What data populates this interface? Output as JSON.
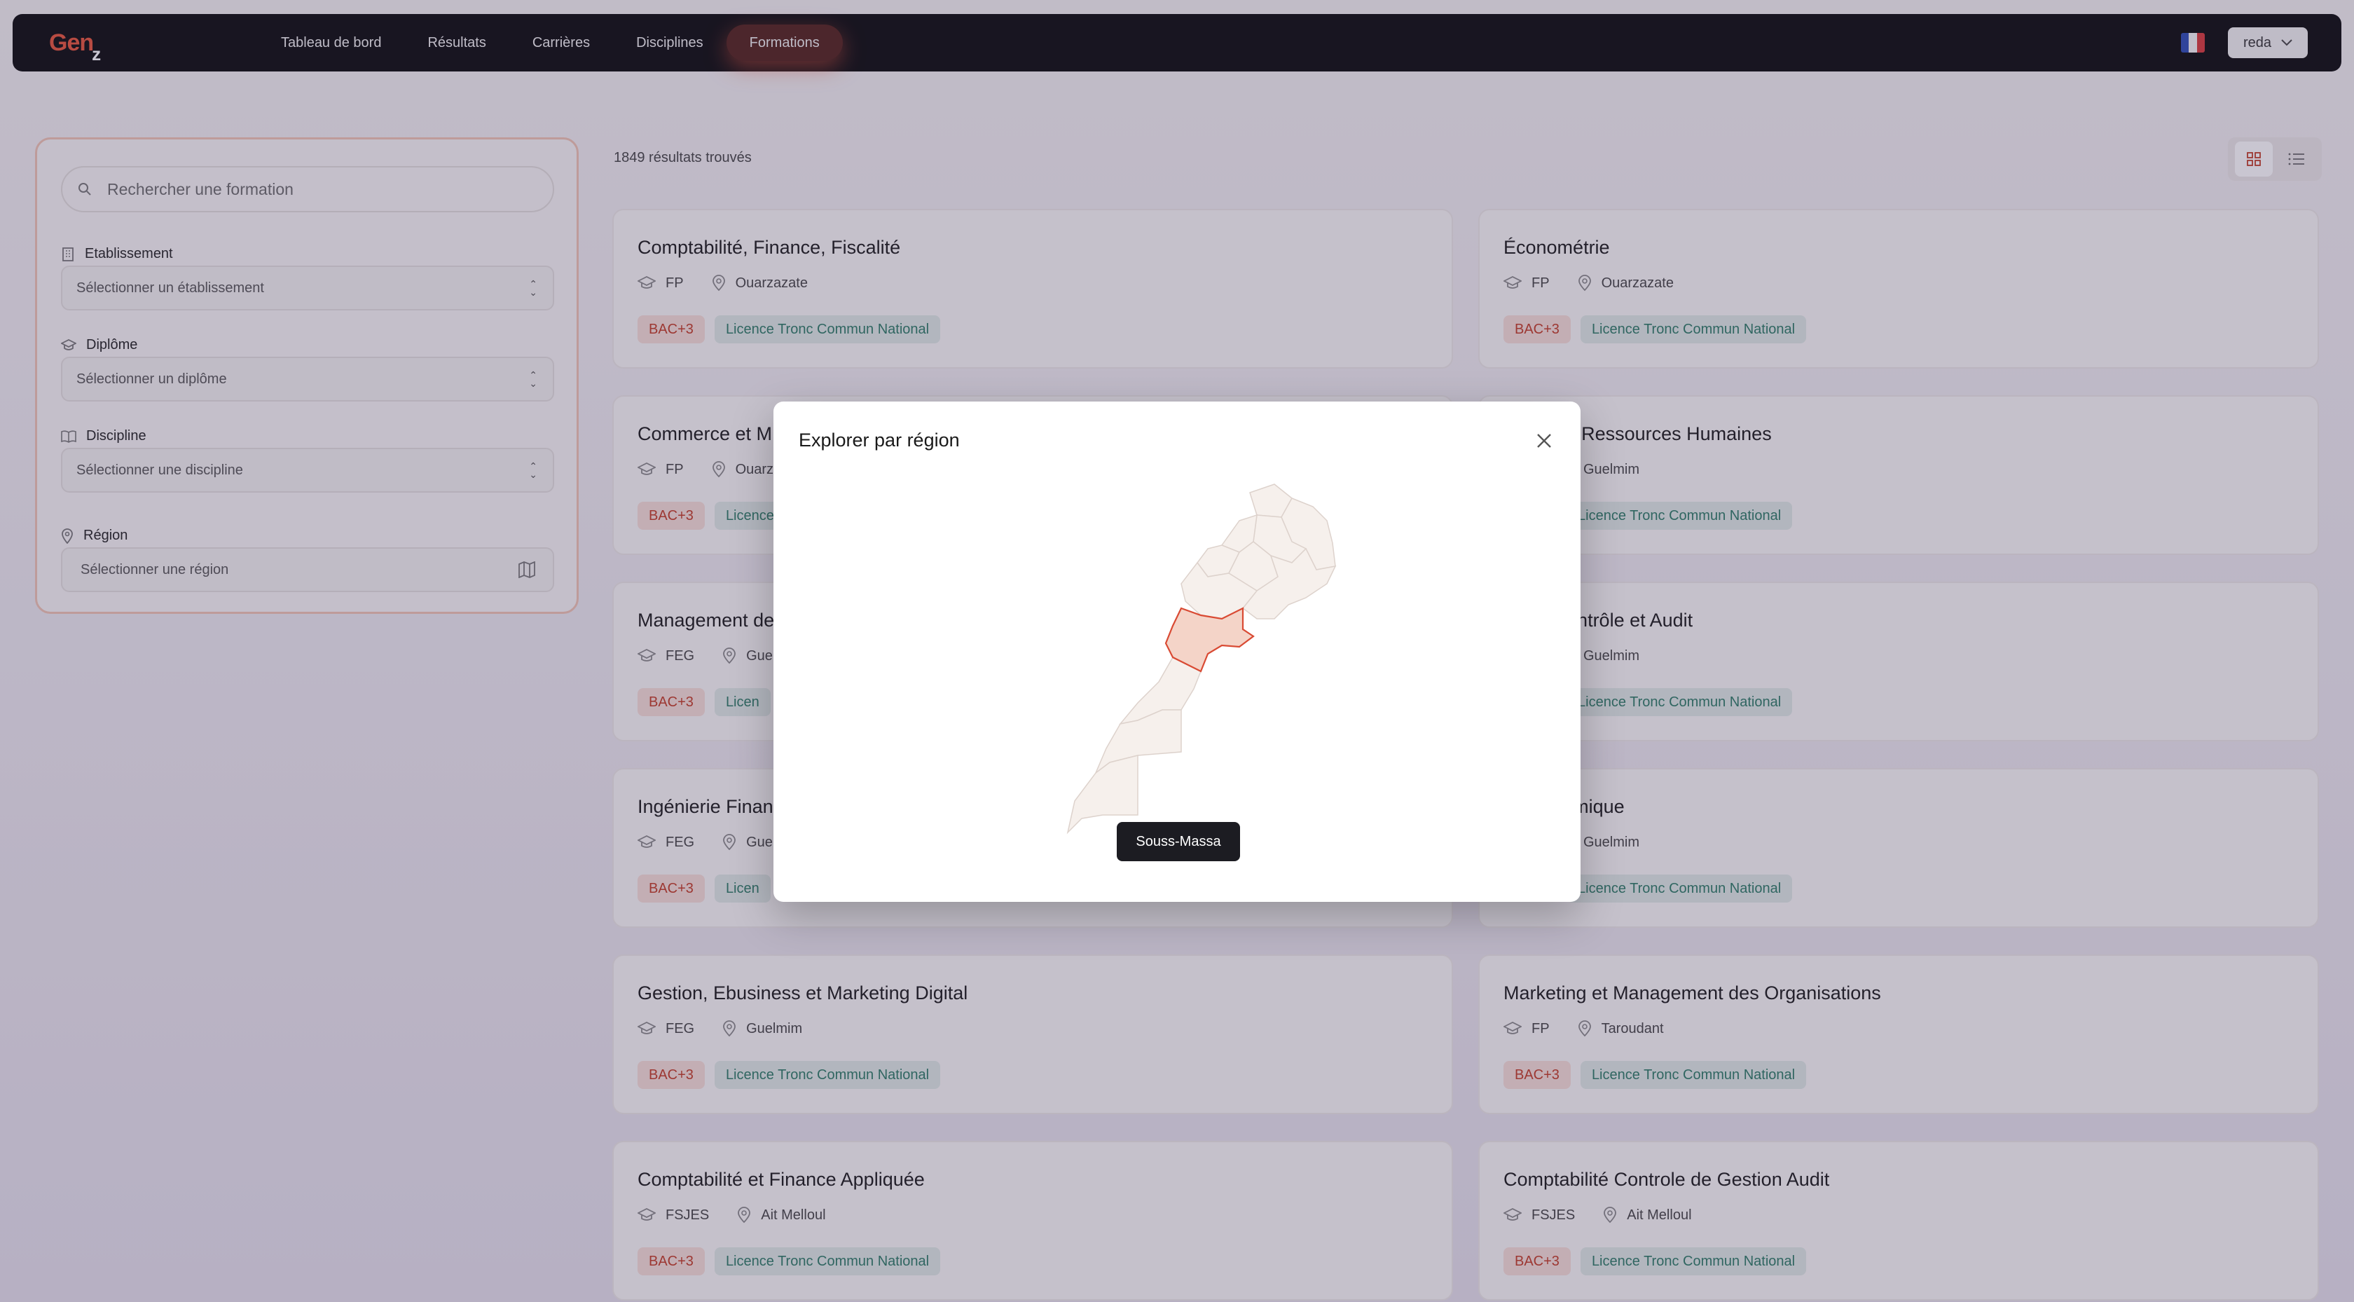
{
  "app": {
    "logo_main": "Gen",
    "logo_sub": "z"
  },
  "nav": {
    "links": [
      "Tableau de bord",
      "Résultats",
      "Carrières",
      "Disciplines",
      "Formations"
    ],
    "active": "Formations",
    "user": "reda",
    "language_flag": "fr"
  },
  "filters": {
    "search_placeholder": "Rechercher une formation",
    "etablissement": {
      "label": "Etablissement",
      "placeholder": "Sélectionner un établissement"
    },
    "diplome": {
      "label": "Diplôme",
      "placeholder": "Sélectionner un diplôme"
    },
    "discipline": {
      "label": "Discipline",
      "placeholder": "Sélectionner une discipline"
    },
    "region": {
      "label": "Région",
      "placeholder": "Sélectionner une région"
    }
  },
  "results": {
    "count_text": "1849 résultats trouvés",
    "cards": [
      {
        "title": "Comptabilité, Finance, Fiscalité",
        "school": "FP",
        "city": "Ouarzazate",
        "level": "BAC+3",
        "type": "Licence Tronc Commun National"
      },
      {
        "title": "Économétrie",
        "school": "FP",
        "city": "Ouarzazate",
        "level": "BAC+3",
        "type": "Licence Tronc Commun National"
      },
      {
        "title": "Commerce et M",
        "school": "FP",
        "city": "Ouarz",
        "level": "BAC+3",
        "type": "Licence"
      },
      {
        "title": "nent des Ressources Humaines",
        "school": "",
        "city": "Guelmim",
        "level": "",
        "type": "Licence Tronc Commun National"
      },
      {
        "title": "Management de",
        "school": "FEG",
        "city": "Guel",
        "level": "BAC+3",
        "type": "Licen"
      },
      {
        "title": "bilité, Contrôle et Audit",
        "school": "",
        "city": "Guelmim",
        "level": "",
        "type": "Licence Tronc Commun National"
      },
      {
        "title": "Ingénierie Finan",
        "school": "FEG",
        "city": "Guel",
        "level": "BAC+3",
        "type": "Licen"
      },
      {
        "title": "e Économique",
        "school": "",
        "city": "Guelmim",
        "level": "",
        "type": "Licence Tronc Commun National"
      },
      {
        "title": "Gestion, Ebusiness et Marketing Digital",
        "school": "FEG",
        "city": "Guelmim",
        "level": "BAC+3",
        "type": "Licence Tronc Commun National"
      },
      {
        "title": "Marketing et Management des Organisations",
        "school": "FP",
        "city": "Taroudant",
        "level": "BAC+3",
        "type": "Licence Tronc Commun National"
      },
      {
        "title": "Comptabilité et Finance Appliquée",
        "school": "FSJES",
        "city": "Ait Melloul",
        "level": "BAC+3",
        "type": "Licence Tronc Commun National"
      },
      {
        "title": "Comptabilité Controle de Gestion Audit",
        "school": "FSJES",
        "city": "Ait Melloul",
        "level": "BAC+3",
        "type": "Licence Tronc Commun National"
      }
    ]
  },
  "modal": {
    "title": "Explorer par région",
    "hovered_region": "Souss-Massa"
  },
  "colors": {
    "accent": "#e8553a",
    "bac_bg": "#f7ded7",
    "bac_text": "#c23b24",
    "licence_bg": "#dfe9e5",
    "licence_text": "#2b7a64"
  }
}
